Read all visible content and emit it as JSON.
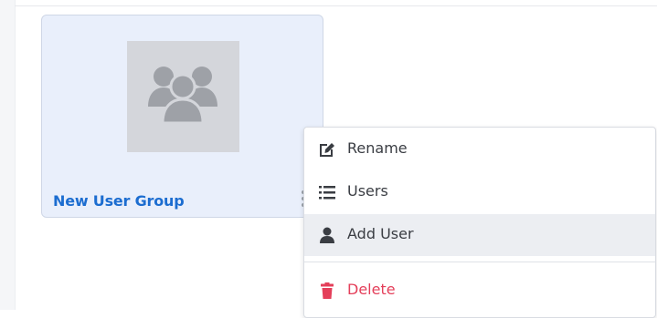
{
  "card": {
    "title": "New User Group",
    "thumbnail_icon": "users-group-icon"
  },
  "context_menu": {
    "items": [
      {
        "label": "Rename",
        "icon": "edit-icon"
      },
      {
        "label": "Users",
        "icon": "list-icon"
      },
      {
        "label": "Add User",
        "icon": "user-icon",
        "highlighted": true
      },
      {
        "label": "Delete",
        "icon": "trash-icon",
        "danger": true
      }
    ]
  },
  "colors": {
    "link_blue": "#1c6dd0",
    "danger_red": "#e43f5a",
    "card_bg": "#e9effb",
    "thumbnail_bg": "#d4d6db"
  }
}
